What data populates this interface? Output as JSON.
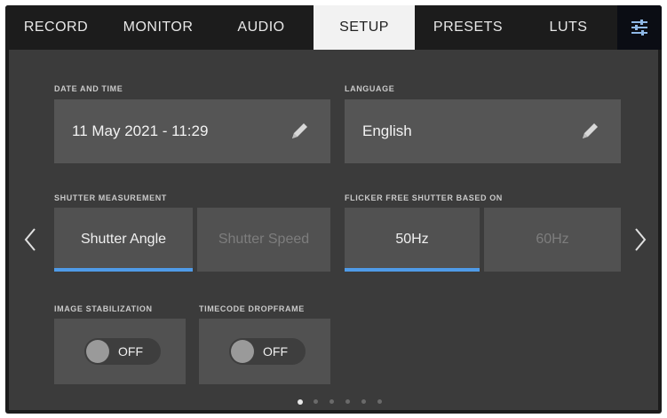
{
  "tabs": [
    {
      "label": "RECORD",
      "active": false
    },
    {
      "label": "MONITOR",
      "active": false
    },
    {
      "label": "AUDIO",
      "active": false
    },
    {
      "label": "SETUP",
      "active": true
    },
    {
      "label": "PRESETS",
      "active": false
    },
    {
      "label": "LUTS",
      "active": false
    }
  ],
  "settings_icon": "sliders-icon",
  "date_time": {
    "label": "DATE AND TIME",
    "value": "11 May 2021 - 11:29",
    "icon": "pencil-icon"
  },
  "language": {
    "label": "LANGUAGE",
    "value": "English",
    "icon": "pencil-icon"
  },
  "shutter_measurement": {
    "label": "SHUTTER MEASUREMENT",
    "options": [
      {
        "label": "Shutter Angle",
        "selected": true
      },
      {
        "label": "Shutter Speed",
        "selected": false
      }
    ]
  },
  "flicker_free": {
    "label": "FLICKER FREE SHUTTER BASED ON",
    "options": [
      {
        "label": "50Hz",
        "selected": true
      },
      {
        "label": "60Hz",
        "selected": false
      }
    ]
  },
  "image_stabilization": {
    "label": "IMAGE STABILIZATION",
    "state": "OFF"
  },
  "timecode_dropframe": {
    "label": "TIMECODE DROPFRAME",
    "state": "OFF"
  },
  "pager": {
    "pages": 6,
    "current": 1
  },
  "colors": {
    "accent": "#4f9be8",
    "background": "#3b3b3b",
    "card": "#555555",
    "tabbar": "#1c1c1c"
  }
}
